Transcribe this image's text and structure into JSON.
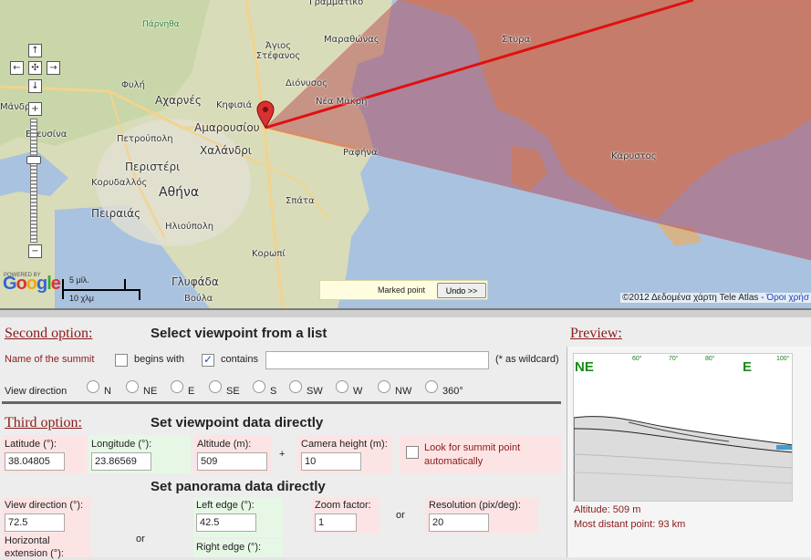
{
  "map": {
    "labels": {
      "parnitha": "Πάρνηθα",
      "grammatiko": "Γραμματικό",
      "agios_stefanos": "Άγιος Στέφανος",
      "marathonas": "Μαραθώνας",
      "fyli": "Φυλή",
      "dionysos": "Διόνυσος",
      "acharnes": "Αχαρνές",
      "nea_makri": "Νέα Μάκρη",
      "kifisia": "Κηφισιά",
      "mandra": "Μάνδρα",
      "amarousiou": "Αμαρουσίου",
      "elefsina": "Ελευσίνα",
      "petroupoli": "Πετρούπολη",
      "chalandri": "Χαλάνδρι",
      "rafina": "Ραφήνα",
      "peristeri": "Περιστέρι",
      "korydallos": "Κορυδαλλός",
      "athina": "Αθήνα",
      "spata": "Σπάτα",
      "peiraias": "Πειραιάς",
      "ilioupoli": "Ηλιούπολη",
      "koropi": "Κορωπί",
      "glyfada": "Γλυφάδα",
      "voula": "Βούλα",
      "styra": "Στύρα",
      "karystos": "Κάρυστος"
    },
    "nav": {
      "up": "↑",
      "down": "↓",
      "left": "←",
      "right": "→",
      "center": "✣",
      "zoom_in": "+",
      "zoom_out": "−"
    },
    "powered_by": "POWERED BY",
    "google": "Google",
    "scale_top": "5 μίλ.",
    "scale_bottom": "10 χλμ",
    "marked_point_label": "Marked point",
    "undo_label": "Undo >>",
    "copyright_text": "©2012 Δεδομένα χάρτη Tele Atlas - ",
    "terms_link": "Όροι χρήσ"
  },
  "second_option": {
    "title": "Second option:",
    "heading": "Select viewpoint from a list",
    "summit_label": "Name of the summit",
    "begins_with_label": "begins with",
    "begins_with_checked": false,
    "contains_label": "contains",
    "contains_checked": true,
    "search_value": "",
    "wildcard_hint": "(* as wildcard)",
    "view_direction_label": "View direction",
    "directions": [
      "N",
      "NE",
      "E",
      "SE",
      "S",
      "SW",
      "W",
      "NW",
      "360°"
    ]
  },
  "third_option": {
    "title": "Third option:",
    "heading": "Set viewpoint data directly",
    "latitude_label": "Latitude (°):",
    "latitude_value": "38.04805",
    "longitude_label": "Longitude (°):",
    "longitude_value": "23.86569",
    "altitude_label": "Altitude (m):",
    "altitude_value": "509",
    "plus": "+",
    "camera_height_label": "Camera height (m):",
    "camera_height_value": "10",
    "look_summit_label": "Look for summit point automatically",
    "look_summit_checked": false,
    "panorama_heading": "Set panorama data directly",
    "view_direction_label": "View direction (°):",
    "view_direction_value": "72.5",
    "horizontal_extension_label": "Horizontal extension (°):",
    "or_1": "or",
    "left_edge_label": "Left edge (°):",
    "left_edge_value": "42.5",
    "right_edge_label": "Right edge (°):",
    "zoom_factor_label": "Zoom factor:",
    "zoom_factor_value": "1",
    "or_2": "or",
    "resolution_label": "Resolution (pix/deg):",
    "resolution_value": "20"
  },
  "preview": {
    "title": "Preview:",
    "dir_ne": "NE",
    "dir_e": "E",
    "deg_60": "60°",
    "deg_70": "70°",
    "deg_80": "80°",
    "deg_100": "100°",
    "altitude_text": "Altitude: 509 m",
    "distant_text": "Most distant point: 93 km"
  },
  "colors": {
    "section_title": "#8b1a1a",
    "direction_green": "#1a8a1a",
    "sight_line": "#e01010",
    "view_wedge": "#b03040"
  }
}
